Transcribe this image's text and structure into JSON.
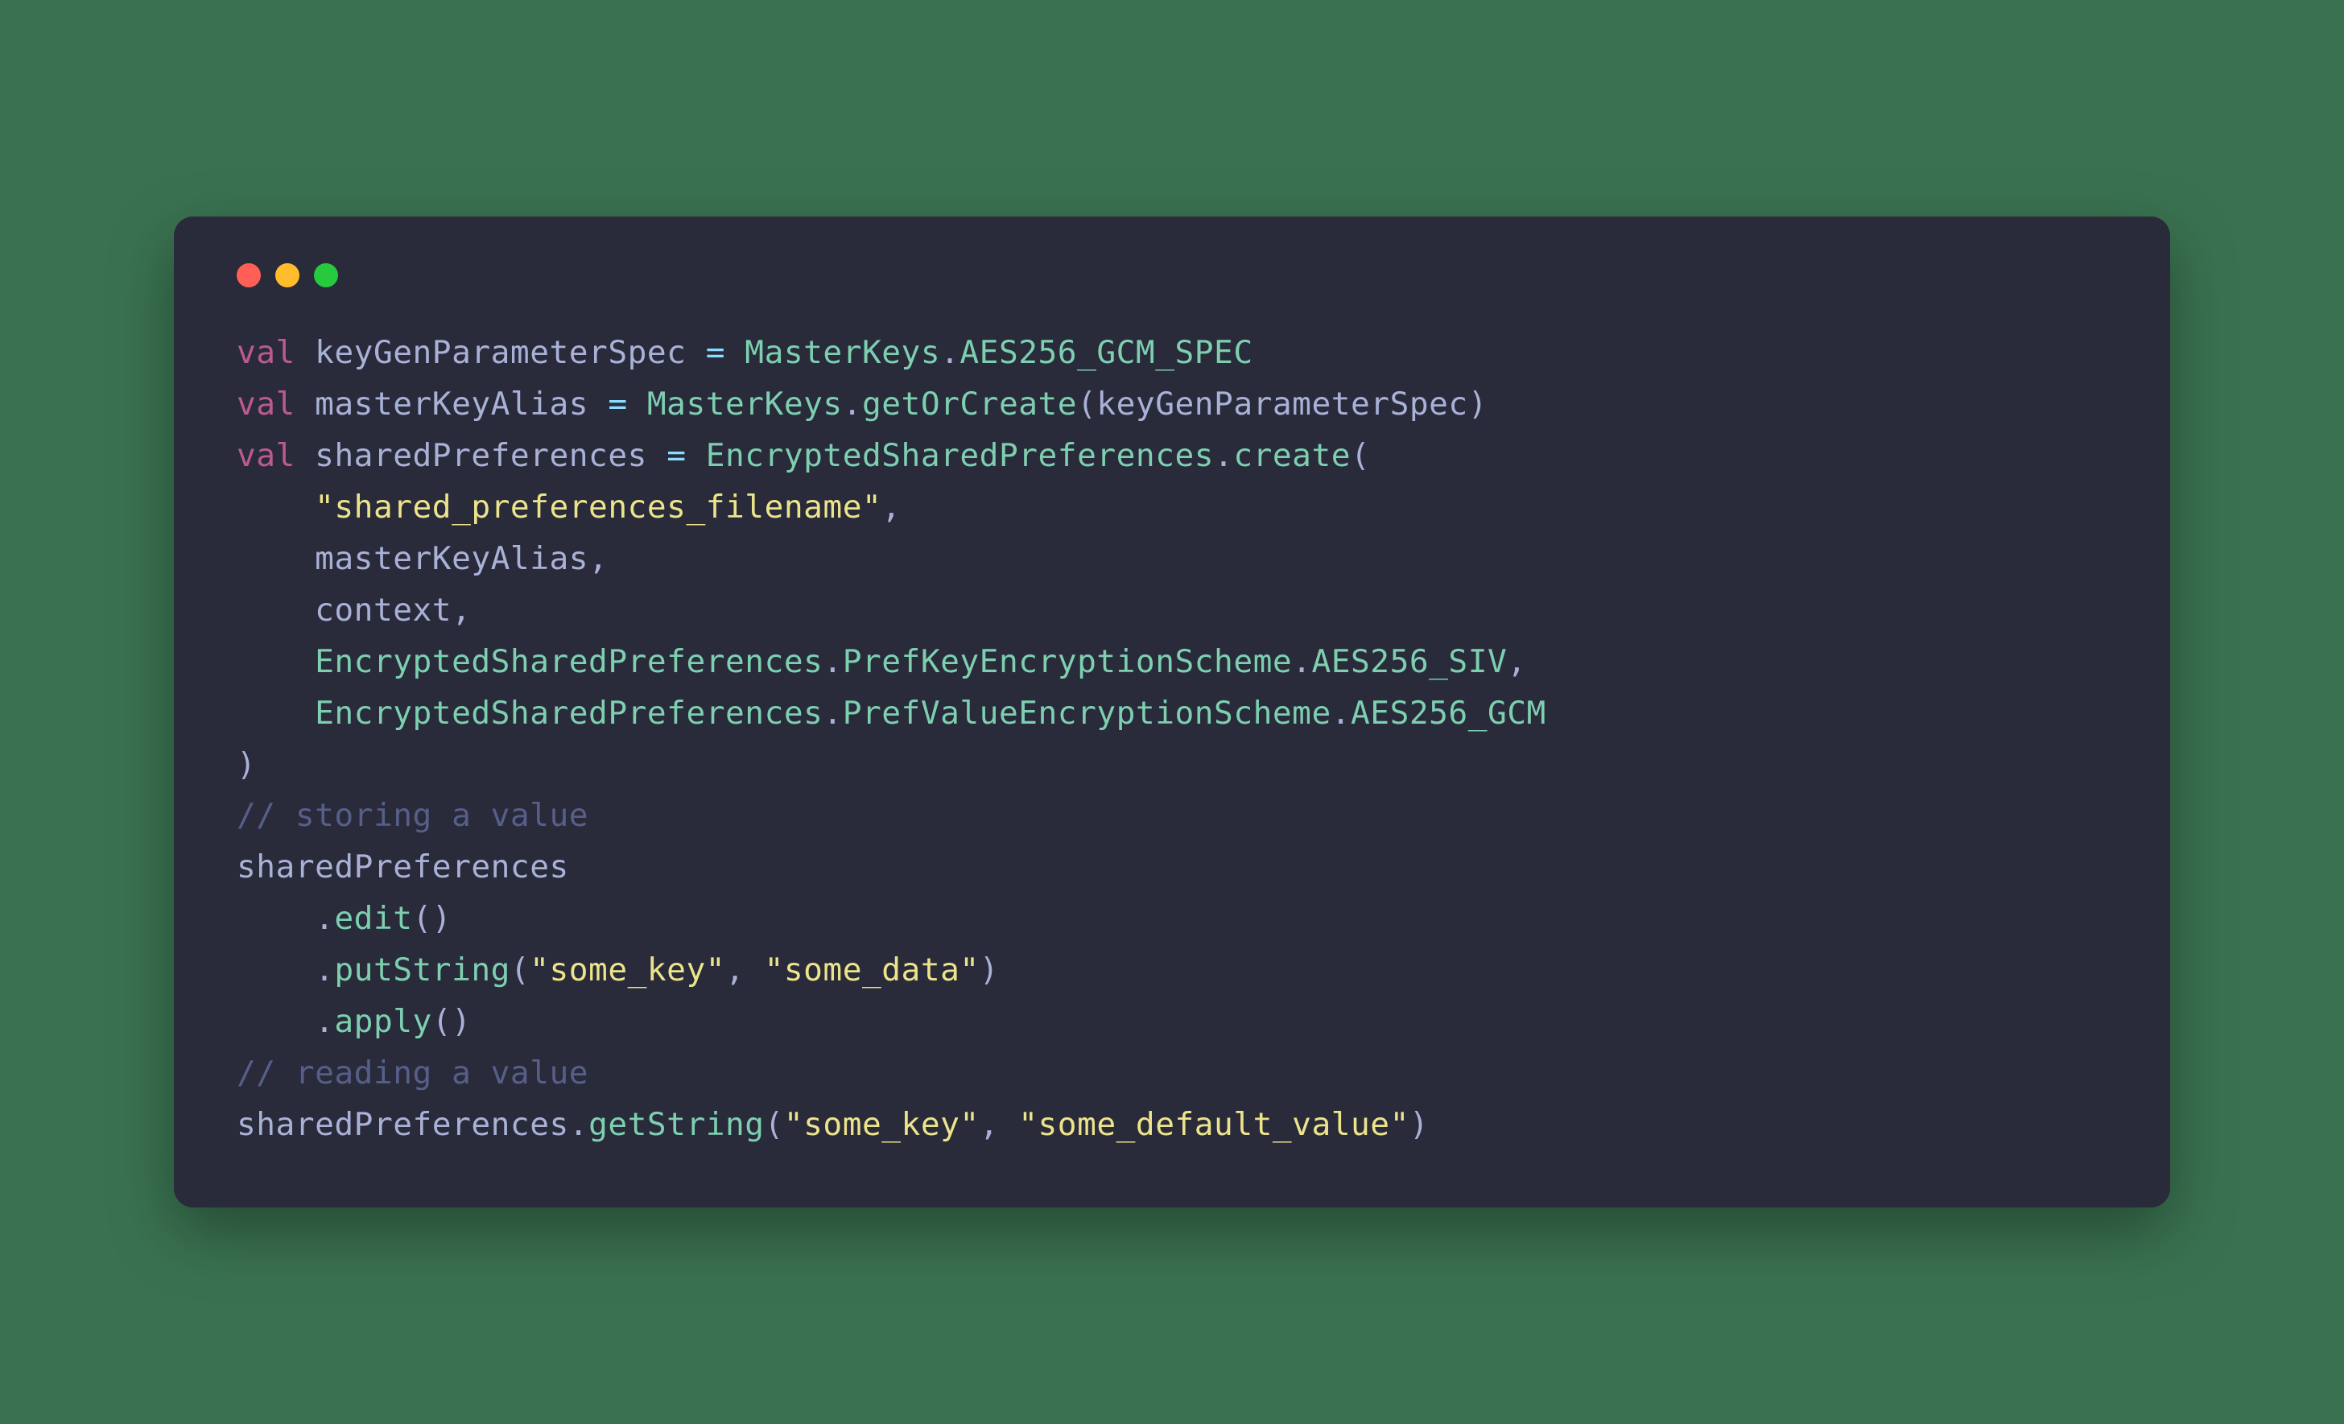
{
  "code": {
    "line1": {
      "kw": "val",
      "ident": " keyGenParameterSpec ",
      "op": "=",
      "type": " MasterKeys",
      "dot": ".",
      "member": "AES256_GCM_SPEC"
    },
    "line2": {
      "kw": "val",
      "ident": " masterKeyAlias ",
      "op": "=",
      "type": " MasterKeys",
      "dot": ".",
      "method": "getOrCreate",
      "lparen": "(",
      "arg": "keyGenParameterSpec",
      "rparen": ")"
    },
    "line3": {
      "kw": "val",
      "ident": " sharedPreferences ",
      "op": "=",
      "type": " EncryptedSharedPreferences",
      "dot": ".",
      "method": "create",
      "lparen": "("
    },
    "line4": {
      "indent": "    ",
      "str": "\"shared_preferences_filename\"",
      "comma": ","
    },
    "line5": {
      "indent": "    ",
      "ident": "masterKeyAlias",
      "comma": ","
    },
    "line6": {
      "indent": "    ",
      "ident": "context",
      "comma": ","
    },
    "line7": {
      "indent": "    ",
      "type1": "EncryptedSharedPreferences",
      "dot1": ".",
      "type2": "PrefKeyEncryptionScheme",
      "dot2": ".",
      "member": "AES256_SIV",
      "comma": ","
    },
    "line8": {
      "indent": "    ",
      "type1": "EncryptedSharedPreferences",
      "dot1": ".",
      "type2": "PrefValueEncryptionScheme",
      "dot2": ".",
      "member": "AES256_GCM"
    },
    "line9": {
      "rparen": ")"
    },
    "line10": {
      "comment": "// storing a value"
    },
    "line11": {
      "ident": "sharedPreferences"
    },
    "line12": {
      "indent": "    ",
      "dot": ".",
      "method": "edit",
      "parens": "()"
    },
    "line13": {
      "indent": "    ",
      "dot": ".",
      "method": "putString",
      "lparen": "(",
      "str1": "\"some_key\"",
      "comma": ", ",
      "str2": "\"some_data\"",
      "rparen": ")"
    },
    "line14": {
      "indent": "    ",
      "dot": ".",
      "method": "apply",
      "parens": "()"
    },
    "line15": {
      "comment": "// reading a value"
    },
    "line16": {
      "ident": "sharedPreferences",
      "dot": ".",
      "method": "getString",
      "lparen": "(",
      "str1": "\"some_key\"",
      "comma": ", ",
      "str2": "\"some_default_value\"",
      "rparen": ")"
    }
  }
}
